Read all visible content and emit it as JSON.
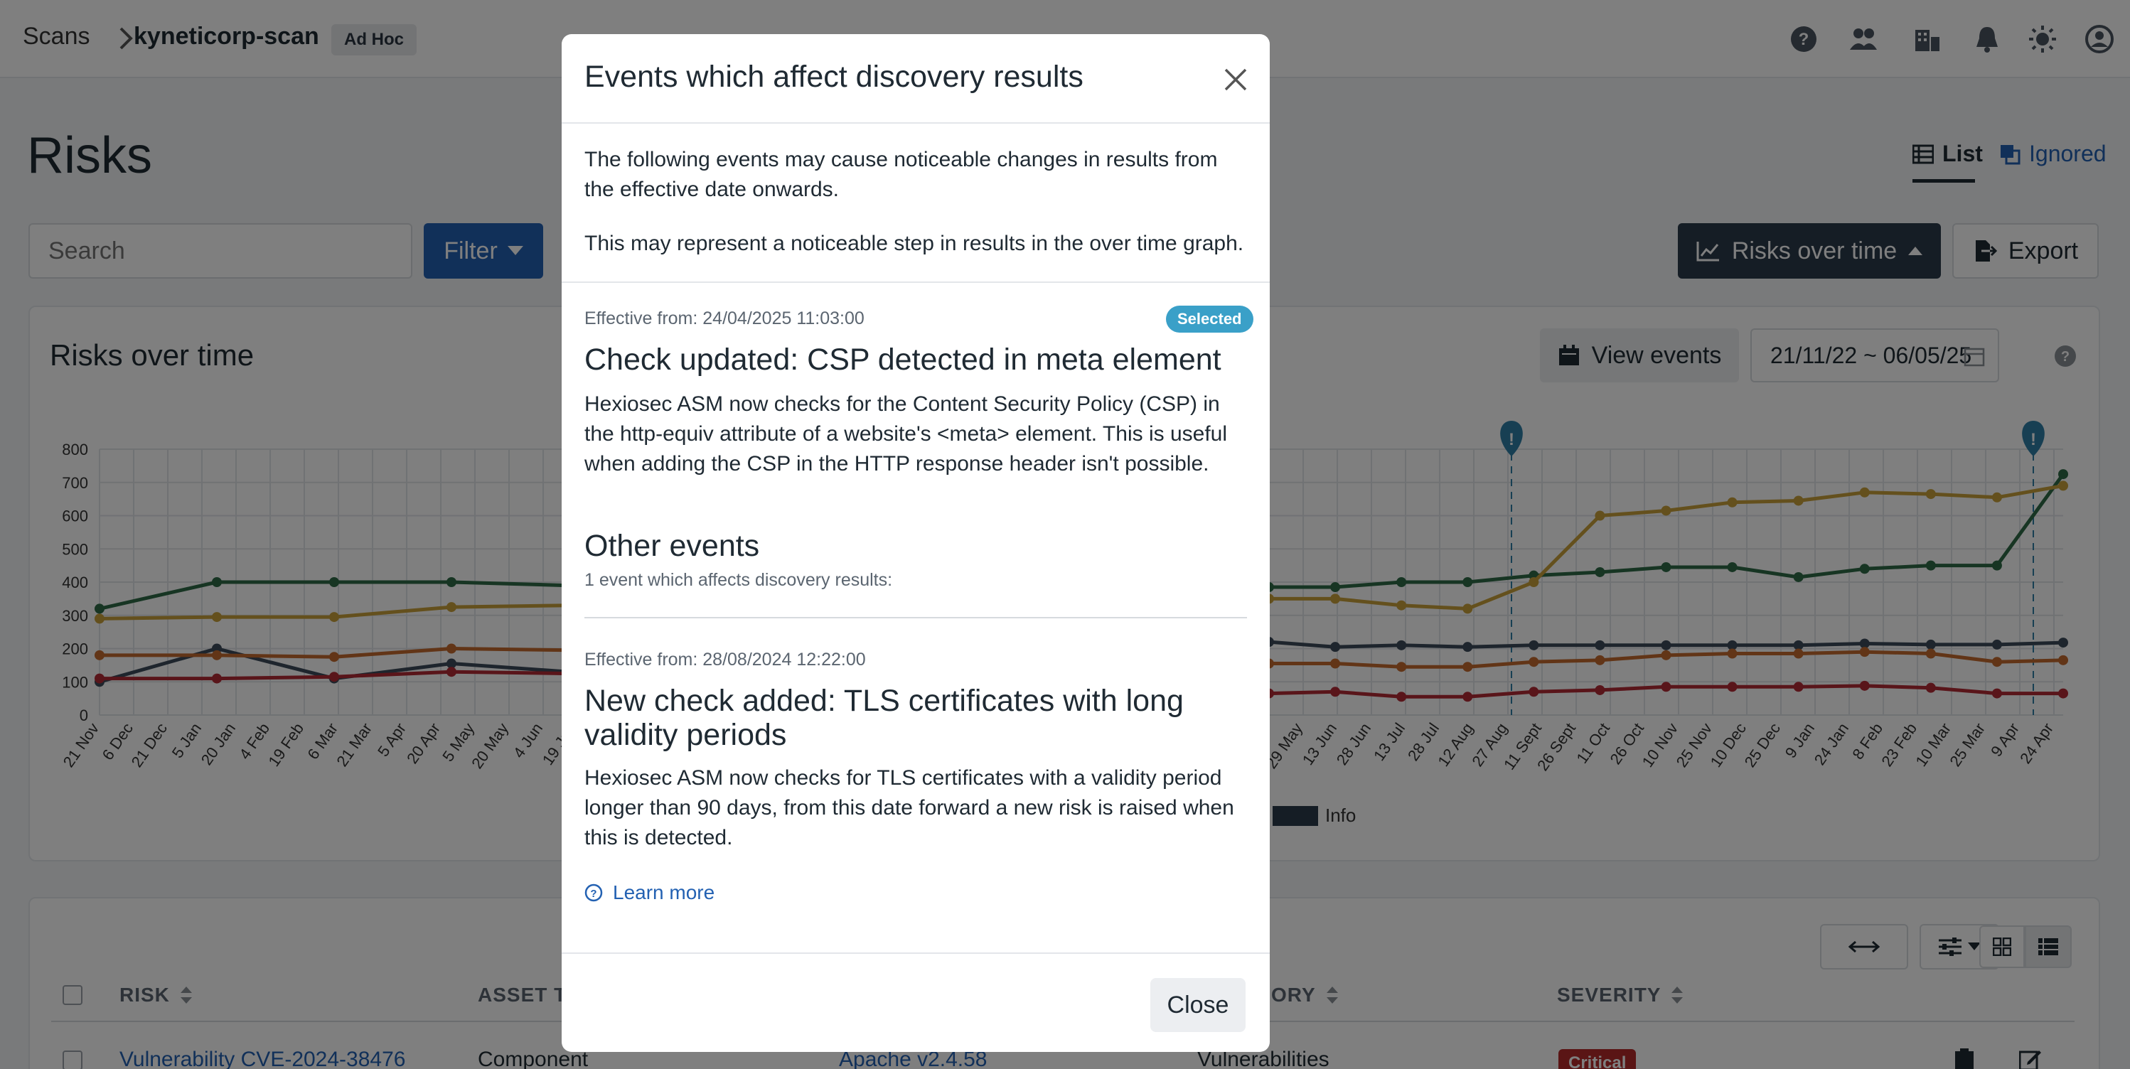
{
  "breadcrumb": {
    "root": "Scans",
    "current": "kyneticorp-scan",
    "badge": "Ad Hoc"
  },
  "page": {
    "title": "Risks"
  },
  "views": {
    "list": "List",
    "ignored": "Ignored"
  },
  "toolbar": {
    "search_placeholder": "Search",
    "filter_label": "Filter",
    "risks_over_time_label": "Risks over time",
    "export_label": "Export"
  },
  "chart_panel": {
    "title": "Risks over time",
    "view_events_label": "View events",
    "date_range": "21/11/22 ~ 06/05/25",
    "legend_visible": "Info"
  },
  "chart_data": {
    "type": "line",
    "ylim": [
      0,
      800
    ],
    "yticks": [
      0,
      100,
      200,
      300,
      400,
      500,
      600,
      700,
      800
    ],
    "categories_left": [
      "21 Nov",
      "6 Dec",
      "21 Dec",
      "5 Jan",
      "20 Jan",
      "4 Feb",
      "19 Feb",
      "6 Mar",
      "21 Mar",
      "5 Apr",
      "20 Apr",
      "5 May",
      "20 May",
      "4 Jun",
      "19 Jun"
    ],
    "categories_right": [
      "...ay",
      "29 May",
      "13 Jun",
      "28 Jun",
      "13 Jul",
      "28 Jul",
      "12 Aug",
      "27 Aug",
      "11 Sept",
      "26 Sept",
      "11 Oct",
      "26 Oct",
      "10 Nov",
      "25 Nov",
      "10 Dec",
      "25 Dec",
      "9 Jan",
      "24 Jan",
      "8 Feb",
      "23 Feb",
      "10 Mar",
      "25 Mar",
      "9 Apr",
      "24 Apr"
    ],
    "event_markers": [
      "28/08/2024",
      "24/04/2025"
    ],
    "series": [
      {
        "color": "#2e6b47",
        "left": [
          320,
          400,
          400,
          400,
          390
        ],
        "right": [
          385,
          385,
          400,
          400,
          420,
          430,
          445,
          445,
          415,
          440,
          450,
          450,
          725
        ]
      },
      {
        "color": "#c9a13a",
        "left": [
          290,
          295,
          295,
          325,
          330
        ],
        "right": [
          350,
          350,
          330,
          320,
          400,
          600,
          615,
          640,
          645,
          670,
          665,
          655,
          690
        ]
      },
      {
        "color": "#3c4a5a",
        "left": [
          100,
          200,
          110,
          155,
          130
        ],
        "right": [
          220,
          205,
          210,
          205,
          210,
          210,
          210,
          210,
          210,
          215,
          212,
          212,
          218
        ]
      },
      {
        "color": "#c46a2e",
        "left": [
          180,
          180,
          175,
          200,
          195
        ],
        "right": [
          155,
          155,
          145,
          145,
          160,
          165,
          180,
          185,
          185,
          190,
          185,
          160,
          165
        ]
      },
      {
        "color": "#b32a35",
        "left": [
          110,
          110,
          115,
          130,
          125
        ],
        "right": [
          65,
          70,
          55,
          55,
          70,
          75,
          85,
          85,
          85,
          88,
          82,
          65,
          65
        ]
      }
    ]
  },
  "table": {
    "headers": {
      "risk": "RISK",
      "asset_type": "ASSET TY",
      "category": "ORY",
      "severity": "SEVERITY"
    },
    "row1": {
      "risk": "Vulnerability CVE-2024-38476",
      "asset_type": "Component",
      "asset": "Apache v2.4.58",
      "category": "Vulnerabilities",
      "severity": "Critical"
    }
  },
  "modal": {
    "title": "Events which affect discovery results",
    "intro1": "The following events may cause noticeable changes in results from the effective date onwards.",
    "intro2": "This may represent a noticeable step in results in the over time graph.",
    "selected_event": {
      "effective": "Effective from: 24/04/2025 11:03:00",
      "badge": "Selected",
      "title": "Check updated: CSP detected in meta element",
      "description": "Hexiosec ASM now checks for the Content Security Policy (CSP) in the http-equiv attribute of a website's <meta> element. This is useful when adding the CSP in the HTTP response header isn't possible."
    },
    "other_title": "Other events",
    "other_subtitle": "1 event which affects discovery results:",
    "other_event": {
      "effective": "Effective from: 28/08/2024 12:22:00",
      "title": "New check added: TLS certificates with long validity periods",
      "description": "Hexiosec ASM now checks for TLS certificates with a validity period longer than 90 days, from this date forward a new risk is raised when this is detected.",
      "learn_more": "Learn more"
    },
    "close_label": "Close"
  }
}
